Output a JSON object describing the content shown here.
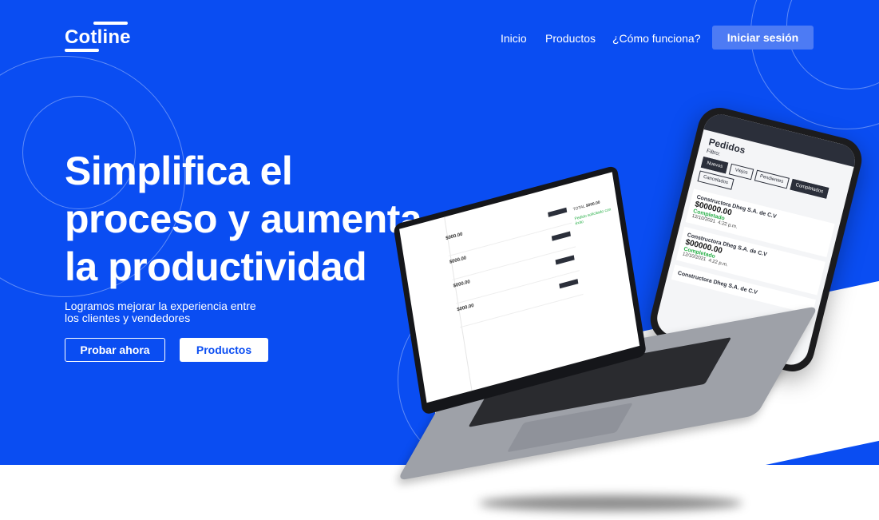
{
  "brand": {
    "name": "Cotline"
  },
  "nav": {
    "items": [
      "Inicio",
      "Productos",
      "¿Cómo funciona?"
    ],
    "login": "Iniciar sesión"
  },
  "hero": {
    "title_lines": [
      "Simplifica el",
      "proceso y aumenta",
      "la productividad"
    ],
    "subtitle": "Logramos mejorar la experiencia entre los clientes y vendedores",
    "cta_primary": "Probar ahora",
    "cta_secondary": "Productos"
  },
  "colors": {
    "brand_blue": "#0a4df2",
    "login_button": "#4d7bf4",
    "white": "#ffffff"
  },
  "phone": {
    "title": "Pedidos",
    "filter": "Filtro:",
    "tabs": [
      "Nuevos",
      "Viejos",
      "Pendientes",
      "Completados",
      "Cancelados"
    ],
    "cards": [
      {
        "name": "Constructora Dheg S.A. de C.V",
        "amount": "$00000.00",
        "status": "Completado",
        "date": "12/10/2021",
        "time": "4:22 p.m."
      },
      {
        "name": "Constructora Dheg S.A. de C.V",
        "amount": "$00000.00",
        "status": "Completado",
        "date": "12/10/2021",
        "time": "4:22 p.m."
      },
      {
        "name": "Constructora Dheg S.A. de C.V",
        "amount": "",
        "status": "",
        "date": "",
        "time": ""
      }
    ]
  },
  "laptop": {
    "prices": [
      "$000.00",
      "$000.00",
      "$000.00",
      "$000.00"
    ],
    "total_label": "TOTAL",
    "total": "$000.00",
    "badge": "Pedido solicitado con éxito"
  }
}
